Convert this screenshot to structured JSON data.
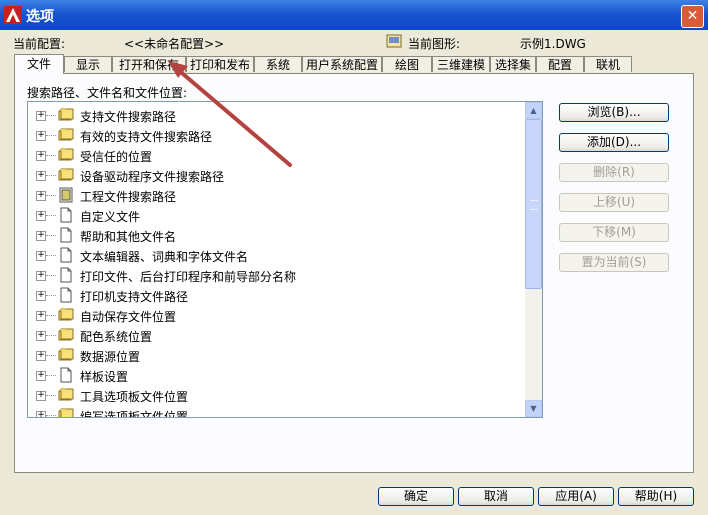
{
  "window": {
    "title": "选项",
    "close_symbol": "✕"
  },
  "config": {
    "label": "当前配置:",
    "value": "<<未命名配置>>"
  },
  "drawing": {
    "label": "当前图形:",
    "value": "示例1.DWG"
  },
  "tabs": [
    {
      "label": "文件",
      "active": true
    },
    {
      "label": "显示"
    },
    {
      "label": "打开和保存"
    },
    {
      "label": "打印和发布"
    },
    {
      "label": "系统"
    },
    {
      "label": "用户系统配置"
    },
    {
      "label": "绘图"
    },
    {
      "label": "三维建模"
    },
    {
      "label": "选择集"
    },
    {
      "label": "配置"
    },
    {
      "label": "联机"
    }
  ],
  "panel": {
    "search_label": "搜索路径、文件名和文件位置:",
    "tree_items": [
      {
        "label": "支持文件搜索路径",
        "icon": "folder-stack-icon"
      },
      {
        "label": "有效的支持文件搜索路径",
        "icon": "folder-stack-icon"
      },
      {
        "label": "受信任的位置",
        "icon": "folder-stack-icon"
      },
      {
        "label": "设备驱动程序文件搜索路径",
        "icon": "folder-stack-icon"
      },
      {
        "label": "工程文件搜索路径",
        "icon": "project-file-icon"
      },
      {
        "label": "自定义文件",
        "icon": "file-icon"
      },
      {
        "label": "帮助和其他文件名",
        "icon": "file-icon"
      },
      {
        "label": "文本编辑器、词典和字体文件名",
        "icon": "file-icon"
      },
      {
        "label": "打印文件、后台打印程序和前导部分名称",
        "icon": "file-icon"
      },
      {
        "label": "打印机支持文件路径",
        "icon": "file-icon"
      },
      {
        "label": "自动保存文件位置",
        "icon": "folder-stack-icon"
      },
      {
        "label": "配色系统位置",
        "icon": "folder-stack-icon"
      },
      {
        "label": "数据源位置",
        "icon": "folder-stack-icon"
      },
      {
        "label": "样板设置",
        "icon": "file-icon"
      },
      {
        "label": "工具选项板文件位置",
        "icon": "folder-stack-icon"
      },
      {
        "label": "编写选项板文件位置",
        "icon": "folder-stack-icon"
      }
    ],
    "side_buttons": [
      {
        "label": "浏览(B)...",
        "enabled": true
      },
      {
        "label": "添加(D)...",
        "enabled": true
      },
      {
        "label": "删除(R)",
        "enabled": false
      },
      {
        "label": "上移(U)",
        "enabled": false
      },
      {
        "label": "下移(M)",
        "enabled": false
      },
      {
        "label": "置为当前(S)",
        "enabled": false
      }
    ]
  },
  "footer": {
    "ok": "确定",
    "cancel": "取消",
    "apply": "应用(A)",
    "help": "帮助(H)"
  },
  "colors": {
    "titlebar": "#0f46c4",
    "annotation_arrow": "#b5423f"
  }
}
